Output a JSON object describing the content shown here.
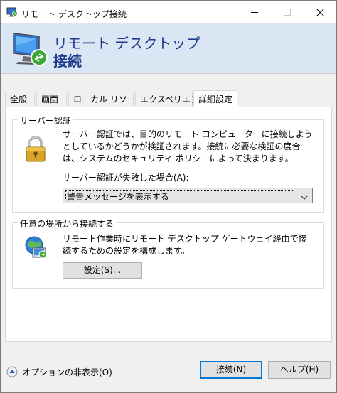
{
  "window": {
    "title": "リモート デスクトップ接続"
  },
  "banner": {
    "line1": "リモート デスクトップ",
    "line2": "接続"
  },
  "tabs": [
    {
      "label": "全般",
      "active": false
    },
    {
      "label": "画面",
      "active": false
    },
    {
      "label": "ローカル リソース",
      "active": false
    },
    {
      "label": "エクスペリエンス",
      "active": false
    },
    {
      "label": "詳細設定",
      "active": true
    }
  ],
  "server_auth": {
    "title": "サーバー認証",
    "description": "サーバー認証では、目的のリモート コンピューターに接続しようとしているかどうかが検証されます。接続に必要な検証の度合は、システムのセキュリティ ポリシーによって決まります。",
    "fail_label": "サーバー認証が失敗した場合(A):",
    "fail_option": "警告メッセージを表示する"
  },
  "connect_anywhere": {
    "title": "任意の場所から接続する",
    "description": "リモート作業時にリモート デスクトップ ゲートウェイ経由で接続するための設定を構成します。",
    "settings_button": "設定(S)..."
  },
  "footer": {
    "options_toggle": "オプションの非表示(O)",
    "connect_button": "接続(N)",
    "help_button": "ヘルプ(H)"
  },
  "icons": {
    "title": "remote-desktop-icon",
    "banner": "remote-desktop-monitor-icon",
    "lock": "lock-icon",
    "globe": "gateway-globe-icon",
    "toggle": "chevron-up-circle-icon"
  },
  "colors": {
    "banner_bg": "#dbe6f4",
    "banner_text": "#1f3c8c",
    "accent": "#0078d7"
  }
}
